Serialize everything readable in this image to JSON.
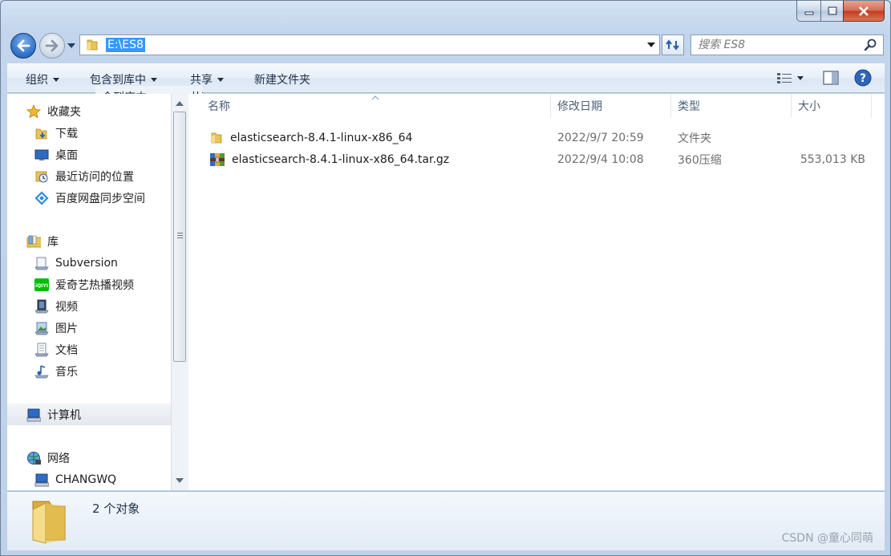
{
  "address": {
    "path": "E:\\ES8"
  },
  "search": {
    "placeholder": "搜索 ES8"
  },
  "toolbar": {
    "organize": "组织",
    "include_in_library": "包含到库中",
    "share": "共享",
    "new_folder": "新建文件夹",
    "ghost_include": "含到库中",
    "ghost_share": "共享"
  },
  "sidebar": {
    "favorites_header": "收藏夹",
    "favorites": [
      "下载",
      "桌面",
      "最近访问的位置",
      "百度网盘同步空间"
    ],
    "libraries_header": "库",
    "libraries": [
      "Subversion",
      "爱奇艺热播视频",
      "视频",
      "图片",
      "文档",
      "音乐"
    ],
    "computer": "计算机",
    "network_header": "网络",
    "network": [
      "CHANGWQ"
    ]
  },
  "columns": {
    "name": "名称",
    "date": "修改日期",
    "type": "类型",
    "size": "大小"
  },
  "files": [
    {
      "name": "elasticsearch-8.4.1-linux-x86_64",
      "date": "2022/9/7 20:59",
      "type": "文件夹",
      "size": "",
      "icon": "folder-icon"
    },
    {
      "name": "elasticsearch-8.4.1-linux-x86_64.tar.gz",
      "date": "2022/9/4 10:08",
      "type": "360压缩",
      "size": "553,013 KB",
      "icon": "archive-icon"
    }
  ],
  "status": {
    "item_count": "2 个对象"
  },
  "watermark": "CSDN @童心同萌",
  "colors": {
    "selection": "#3399ff",
    "folder": "#e8c45a",
    "text_header": "#4c607a"
  }
}
